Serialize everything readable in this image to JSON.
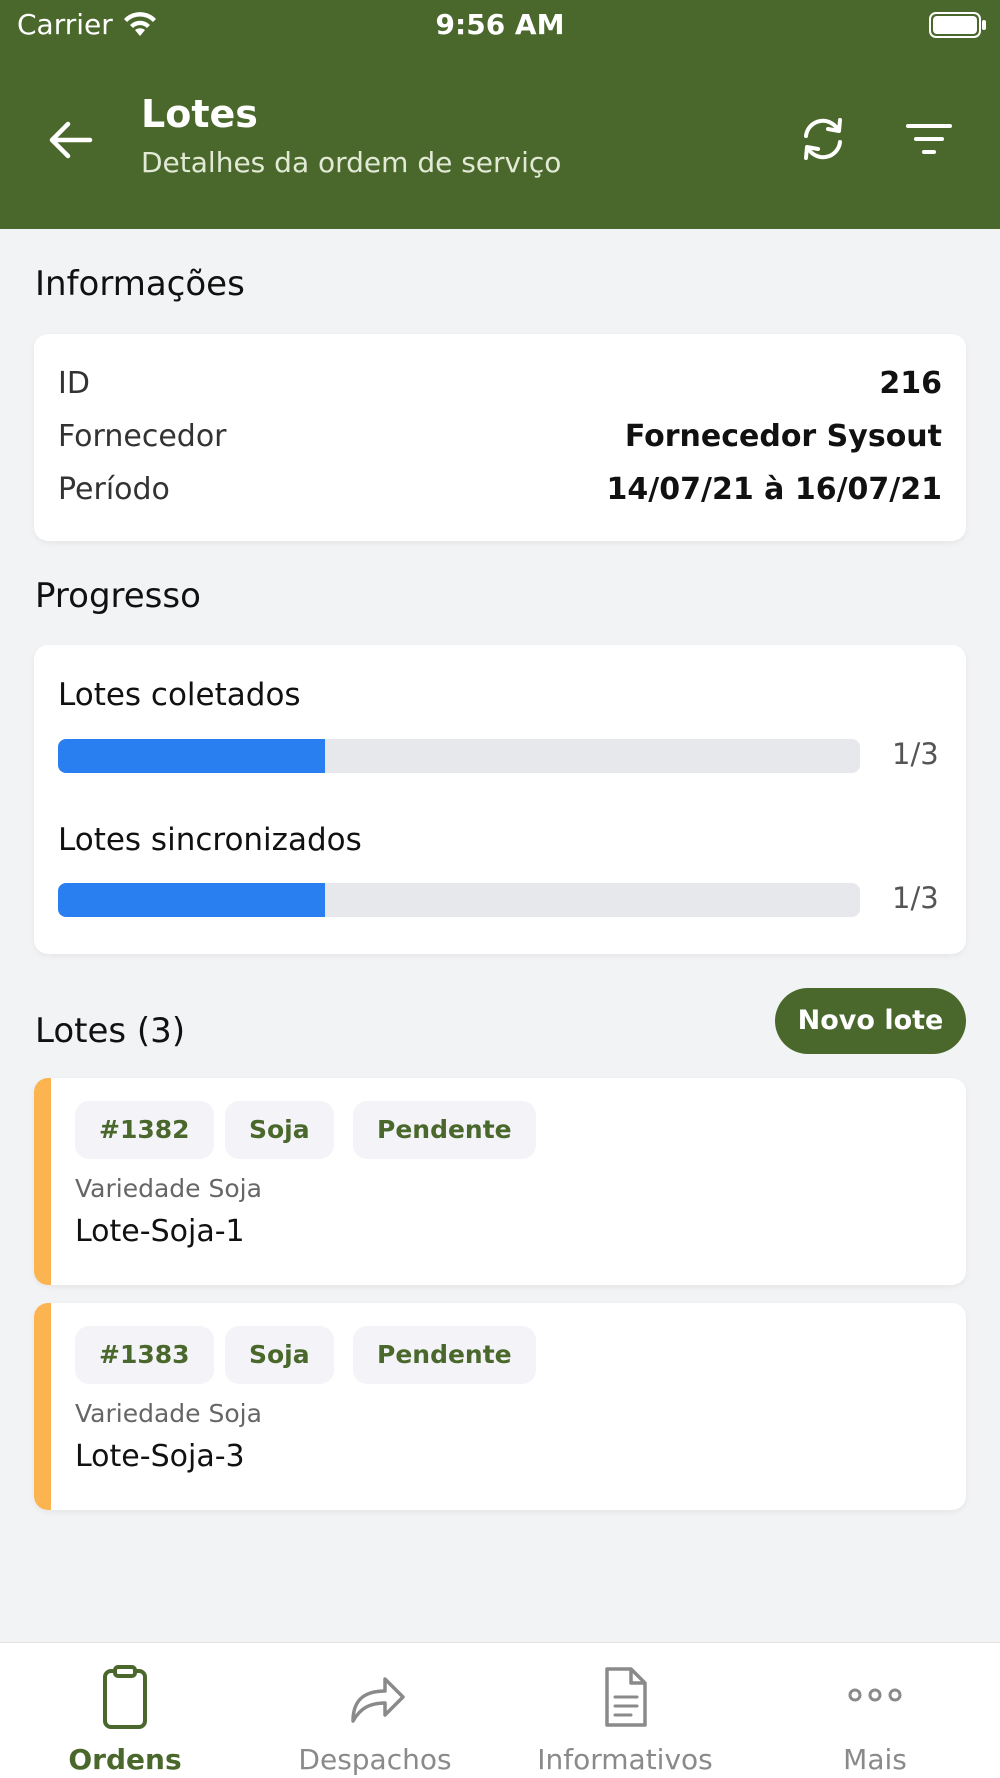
{
  "status_bar": {
    "carrier": "Carrier",
    "time": "9:56 AM"
  },
  "header": {
    "title": "Lotes",
    "subtitle": "Detalhes da ordem de serviço"
  },
  "info": {
    "section_title": "Informações",
    "rows": [
      {
        "label": "ID",
        "value": "216"
      },
      {
        "label": "Fornecedor",
        "value": "Fornecedor Sysout"
      },
      {
        "label": "Período",
        "value": "14/07/21 à 16/07/21"
      }
    ]
  },
  "progress": {
    "section_title": "Progresso",
    "items": [
      {
        "label": "Lotes coletados",
        "count": "1/3",
        "fraction": 0.333
      },
      {
        "label": "Lotes sincronizados",
        "count": "1/3",
        "fraction": 0.333
      }
    ],
    "fill_color": "#2a7ff0"
  },
  "lotes": {
    "section_title": "Lotes (3)",
    "new_button": "Novo lote",
    "items": [
      {
        "id": "#1382",
        "crop": "Soja",
        "status": "Pendente",
        "variety": "Variedade Soja",
        "name": "Lote-Soja-1"
      },
      {
        "id": "#1383",
        "crop": "Soja",
        "status": "Pendente",
        "variety": "Variedade Soja",
        "name": "Lote-Soja-3"
      }
    ],
    "stripe_color": "#fbb450"
  },
  "tabbar": {
    "tabs": [
      {
        "label": "Ordens",
        "icon": "clipboard-icon",
        "active": true
      },
      {
        "label": "Despachos",
        "icon": "share-arrow-icon",
        "active": false
      },
      {
        "label": "Informativos",
        "icon": "document-icon",
        "active": false
      },
      {
        "label": "Mais",
        "icon": "more-dots-icon",
        "active": false
      }
    ]
  },
  "colors": {
    "brand": "#4a682c",
    "background": "#f2f3f5"
  }
}
